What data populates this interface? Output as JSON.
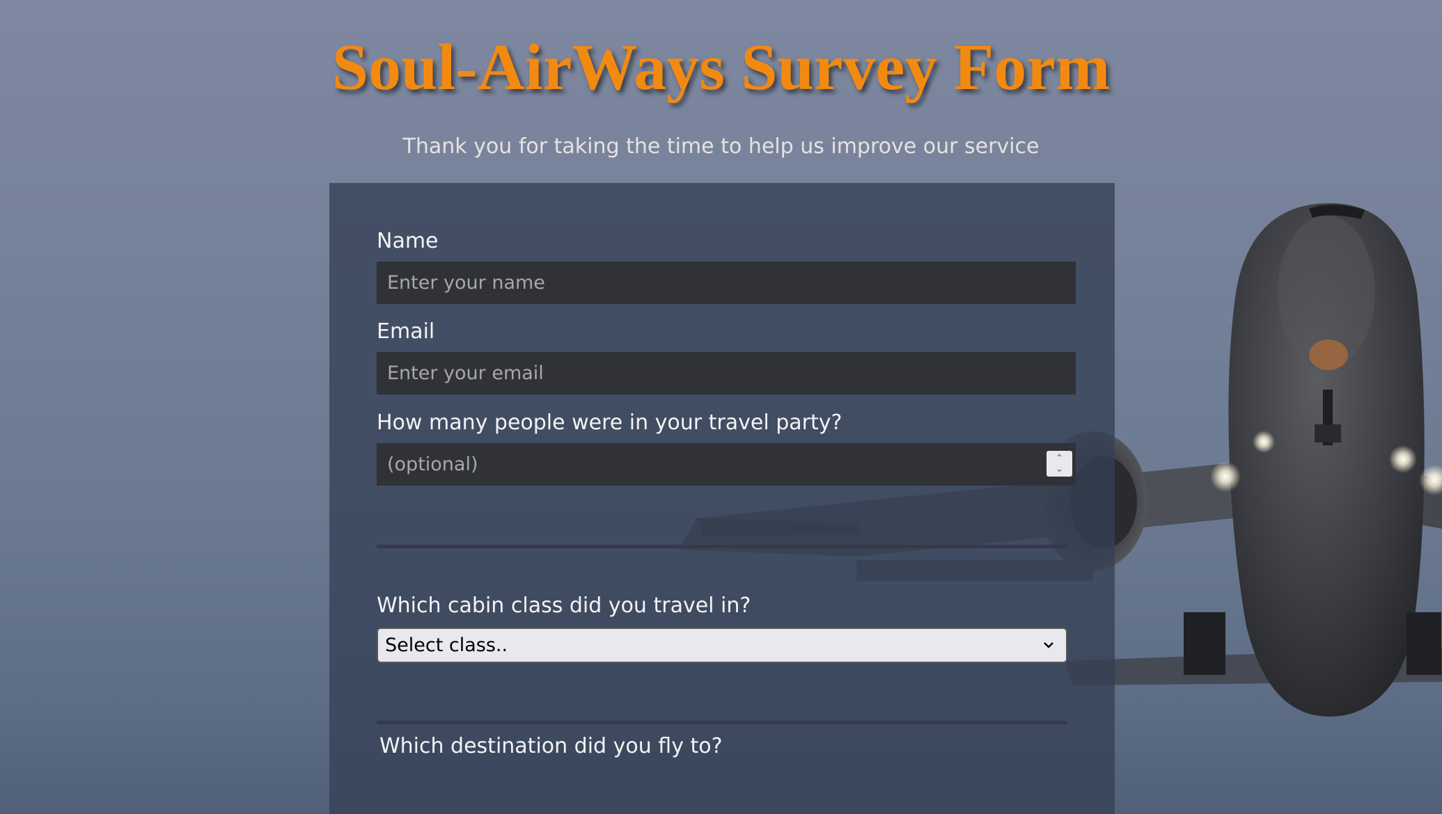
{
  "header": {
    "title": "Soul-AirWays Survey Form",
    "subtitle": "Thank you for taking the time to help us improve our service"
  },
  "form": {
    "name": {
      "label": "Name",
      "placeholder": "Enter your name",
      "value": ""
    },
    "email": {
      "label": "Email",
      "placeholder": "Enter your email",
      "value": ""
    },
    "party_size": {
      "label": "How many people were in your travel party?",
      "placeholder": "(optional)",
      "value": ""
    },
    "cabin_class": {
      "label": "Which cabin class did you travel in?",
      "selected": "Select class.."
    },
    "destination": {
      "label": "Which destination did you fly to?"
    }
  },
  "icons": {
    "spinner": "number-stepper-icon",
    "select_arrow": "chevron-down-icon",
    "background": "airplane-background-image"
  },
  "colors": {
    "title": "#f28a12",
    "subtitle": "#e6e2e0",
    "panel": "#344054",
    "input_bg": "#303238",
    "select_bg": "#e9e8ee"
  }
}
